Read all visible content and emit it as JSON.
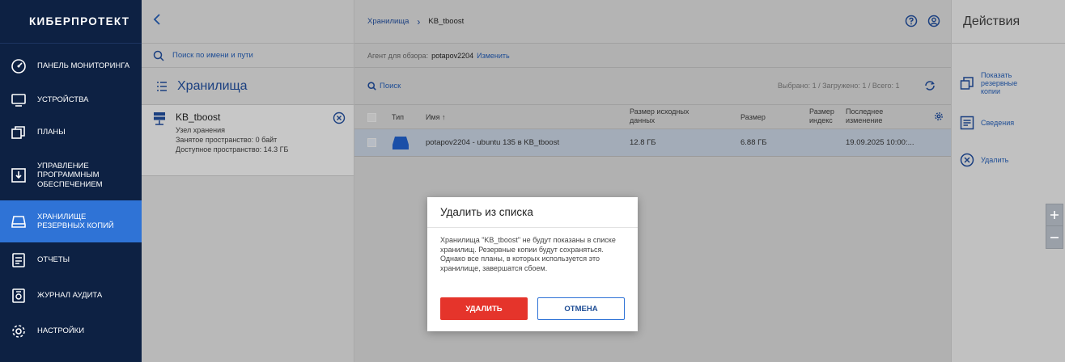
{
  "sidebar": {
    "logo": "КИБЕРПРОТЕКТ",
    "items": [
      {
        "label": "ПАНЕЛЬ МОНИТОРИНГА",
        "icon": "dashboard-icon"
      },
      {
        "label": "УСТРОЙСТВА",
        "icon": "monitor-icon"
      },
      {
        "label": "ПЛАНЫ",
        "icon": "plans-icon"
      },
      {
        "label": "УПРАВЛЕНИЕ ПРОГРАММНЫМ ОБЕСПЕЧЕНИЕМ",
        "icon": "software-icon"
      },
      {
        "label": "ХРАНИЛИЩЕ РЕЗЕРВНЫХ КОПИЙ",
        "icon": "storage-icon",
        "active": true
      },
      {
        "label": "ОТЧЕТЫ",
        "icon": "report-icon"
      },
      {
        "label": "ЖУРНАЛ АУДИТА",
        "icon": "audit-icon"
      },
      {
        "label": "НАСТРОЙКИ",
        "icon": "gear-icon"
      }
    ]
  },
  "left_panel": {
    "search_placeholder": "Поиск по имени и пути",
    "title": "Хранилища",
    "storage": {
      "name": "KB_tboost",
      "type": "Узел хранения",
      "used": "Занятое пространство: 0 байт",
      "available": "Доступное пространство: 14.3 ГБ"
    }
  },
  "main": {
    "breadcrumb": {
      "root": "Хранилища",
      "separator": "›",
      "current": "KB_tboost"
    },
    "agent_label": "Агент для обзора:",
    "agent_value": "potapov2204",
    "agent_change": "Изменить",
    "search_label": "Поиск",
    "selection_info": "Выбрано: 1 / Загружено: 1 / Всего: 1",
    "columns": {
      "type": "Тип",
      "name": "Имя ↑",
      "source_size": "Размер исходных данных",
      "size": "Размер",
      "index_size": "Размер индекс",
      "modified": "Последнее изменение"
    },
    "rows": [
      {
        "name": "potapov2204 - ubuntu 135 в KB_tboost",
        "source_size": "12.8 ГБ",
        "size": "6.88 ГБ",
        "modified": "19.09.2025 10:00:..."
      }
    ]
  },
  "right_panel": {
    "title": "Действия",
    "actions": [
      {
        "label": "Показать резервные копии",
        "icon": "copy-icon"
      },
      {
        "label": "Сведения",
        "icon": "details-icon"
      },
      {
        "label": "Удалить",
        "icon": "close-circle-icon"
      }
    ]
  },
  "modal": {
    "title": "Удалить из списка",
    "body": "Хранилища \"KB_tboost\" не будут показаны в списке хранилищ. Резервные копии будут сохраняться. Однако все планы, в которых используется это хранилище, завершатся сбоем.",
    "delete_label": "УДАЛИТЬ",
    "cancel_label": "ОТМЕНА"
  },
  "colors": {
    "sidebar_bg": "#0d2143",
    "active": "#2f73d6",
    "danger": "#e5342b",
    "link": "#1e4d95"
  }
}
